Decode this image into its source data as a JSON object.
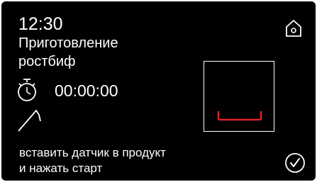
{
  "header": {
    "time": "12:30",
    "program_line1": "Приготовление",
    "program_line2": "ростбиф"
  },
  "timer": {
    "value": "00:00:00",
    "icon": "stopwatch-icon"
  },
  "probe": {
    "icon": "meat-probe-icon"
  },
  "instruction": {
    "line1": "вставить датчик в продукт",
    "line2": "и нажать старт"
  },
  "icons": {
    "home": "home-icon",
    "confirm": "checkmark-circle-icon"
  },
  "colors": {
    "background": "#000000",
    "foreground": "#ffffff",
    "tray_accent": "#e0202a"
  }
}
